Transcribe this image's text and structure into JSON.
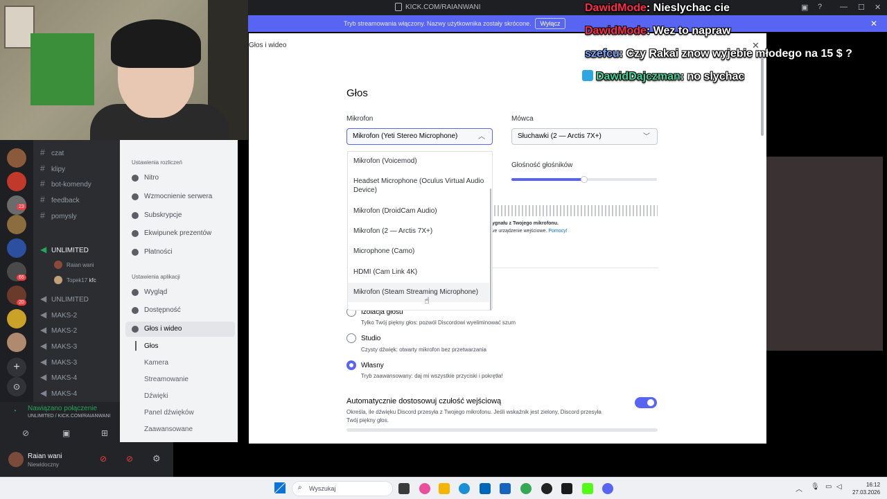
{
  "browser": {
    "url": "KICK.COM/RAIANWANI"
  },
  "stream_banner": {
    "text": "Tryb streamowania włączony. Nazwy użytkownika zostały skrócone.",
    "button": "Wyłącz"
  },
  "channels": [
    {
      "name": "czat",
      "icon": "hash"
    },
    {
      "name": "klipy",
      "icon": "hash"
    },
    {
      "name": "bot-komendy",
      "icon": "hash"
    },
    {
      "name": "feedback",
      "icon": "hash"
    },
    {
      "name": "pomysly",
      "icon": "hash"
    },
    {
      "name": "UNLIMITED",
      "icon": "speaker"
    },
    {
      "name": "Raian wani",
      "icon": "avatar"
    },
    {
      "name": "Topek17",
      "icon": "avatar"
    },
    {
      "name": "kfc",
      "icon": "none"
    },
    {
      "name": "UNLIMITED",
      "icon": "speaker"
    },
    {
      "name": "MAKS-2",
      "icon": "speaker"
    },
    {
      "name": "MAKS-2",
      "icon": "speaker"
    },
    {
      "name": "MAKS-3",
      "icon": "speaker"
    },
    {
      "name": "MAKS-3",
      "icon": "speaker"
    },
    {
      "name": "MAKS-4",
      "icon": "speaker"
    },
    {
      "name": "MAKS-4",
      "icon": "speaker"
    }
  ],
  "server_badges": [
    "23",
    "65",
    "20"
  ],
  "voice": {
    "status": "Nawiązano połączenie",
    "sub": "UNLIMITED / KICK.COM/RAIANWANI"
  },
  "user": {
    "name": "Raian wani",
    "status": "Niewidoczny"
  },
  "settings_nav": {
    "billing_header": "Ustawienia rozliczeń",
    "billing": [
      "Nitro",
      "Wzmocnienie serwera",
      "Subskrypcje",
      "Ekwipunek prezentów",
      "Płatności"
    ],
    "app_header": "Ustawienia aplikacji",
    "app": [
      "Wygląd",
      "Dostępność",
      "Głos i wideo"
    ],
    "voice_sub": [
      "Głos",
      "Kamera",
      "Streamowanie",
      "Dźwięki",
      "Panel dźwięków",
      "Zaawansowane"
    ]
  },
  "modal": {
    "breadcrumb": "Głos i wideo",
    "title": "Głos",
    "mic_label": "Mikrofon",
    "mic_selected": "Mikrofon (Yeti Stereo Microphone)",
    "speaker_label": "Mówca",
    "speaker_selected": "Słuchawki (2 — Arctis 7X+)",
    "speaker_volume_label": "Głośność głośników",
    "speaker_volume": 0.5,
    "mic_options": [
      "Mikrofon (Voicemod)",
      "Headset Microphone (Oculus Virtual Audio Device)",
      "Mikrofon (DroidCam Audio)",
      "Mikrofon (2 — Arctis 7X+)",
      "Microphone (Camo)",
      "HDMI (Cam Link 4K)",
      "Mikrofon (Steam Streaming Microphone)"
    ],
    "meter_text_1": "ygnału z Twojego mikrofonu.",
    "meter_text_2": "ve urządzenie wejściowe.",
    "help_link": "Pomocy!",
    "modes": [
      {
        "label": "Izolacja głosu",
        "desc": "Tylko Twój piękny głos: pozwól Discordowi wyeliminować szum",
        "selected": false
      },
      {
        "label": "Studio",
        "desc": "Czysty dźwięk: otwarty mikrofon bez przetwarzania",
        "selected": false
      },
      {
        "label": "Własny",
        "desc": "Tryb zaawansowany: daj mi wszystkie przyciski i pokrętła!",
        "selected": true
      }
    ],
    "auto_label": "Automatycznie dostosowuj czułość wejściową",
    "auto_desc": "Określa, ile dźwięku Discord przesyła z Twojego mikrofonu. Jeśli wskaźnik jest zielony, Discord przesyła Twój piękny głos.",
    "auto_enabled": true
  },
  "chat": [
    {
      "user": "DawidMode",
      "msg": ": Nieslychac cie",
      "color": "u1",
      "badge": false
    },
    {
      "user": "DawidMode",
      "msg": ": Wez to napraw",
      "color": "u1",
      "badge": false
    },
    {
      "user": "szefcu",
      "msg": ": Czy Rakai znow wyjebie młodego na 15 $ ?",
      "color": "u2",
      "badge": false
    },
    {
      "user": "DawidDajczman",
      "msg": ": no slychac",
      "color": "u3",
      "badge": true
    }
  ],
  "taskbar": {
    "search": "Wyszukaj",
    "time": "16:12",
    "date": "27.03.2026"
  }
}
